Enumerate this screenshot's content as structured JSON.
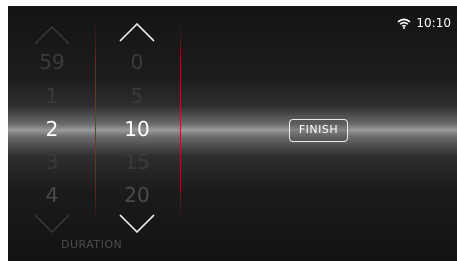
{
  "status": {
    "time": "10:10",
    "wifi_icon": "wifi-icon"
  },
  "picker": {
    "columns": [
      {
        "name": "left",
        "values": [
          "59",
          "1",
          "2",
          "3",
          "4"
        ],
        "selected": "2"
      },
      {
        "name": "right",
        "values": [
          "0",
          "5",
          "10",
          "15",
          "20"
        ],
        "selected": "10"
      }
    ],
    "label": "DURATION",
    "up_icon": "chevron-up-icon",
    "down_icon": "chevron-down-icon"
  },
  "actions": {
    "finish_label": "FINISH"
  },
  "colors": {
    "divider": "#b02020",
    "highlight_band": "#9a9a9a",
    "text_bright": "#ffffff",
    "text_dim": "#4a4a4a"
  }
}
